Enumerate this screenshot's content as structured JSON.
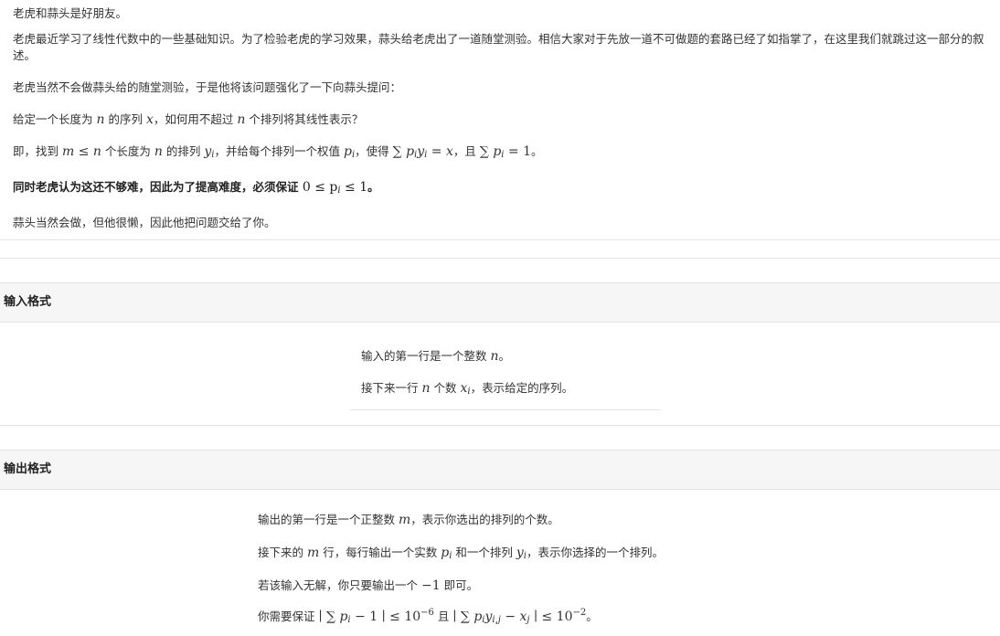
{
  "intro": {
    "p1": "老虎和蒜头是好朋友。",
    "p2": "老虎最近学习了线性代数中的一些基础知识。为了检验老虎的学习效果，蒜头给老虎出了一道随堂测验。相信大家对于先放一道不可做题的套路已经了如指掌了，在这里我们就跳过这一部分的叙述。",
    "p3": "老虎当然不会做蒜头给的随堂测验，于是他将该问题强化了一下向蒜头提问：",
    "p4a": "给定一个长度为 ",
    "p4b": " 的序列 ",
    "p4c": "，如何用不超过 ",
    "p4d": " 个排列将其线性表示？",
    "p5a": "即，找到 ",
    "p5b": " 个长度为 ",
    "p5c": " 的排列 ",
    "p5d": "，并给每个排列一个权值 ",
    "p5e": "，使得 ",
    "p5f": "，且 ",
    "p5g": "。",
    "p6a": "同时老虎认为这还不够难，因此为了提高难度，必须保证 ",
    "p6b": "。",
    "p7": "蒜头当然会做，但他很懒，因此他把问题交给了你。"
  },
  "math": {
    "n": "n",
    "x": "x",
    "m_le_n": "m ≤ n",
    "y_i": "y",
    "p_i": "p",
    "i": "i",
    "sum_py": "∑ p",
    "eq_x": " = x",
    "sum_p": "∑ p",
    "eq_1": " = 1",
    "range": "0 ≤ p",
    "le1": " ≤ 1",
    "m": "m",
    "x_i": "x",
    "minus1": "−1",
    "cond1a": "∣ ∑ p",
    "cond1b": " − 1 ∣ ≤ 10",
    "exp6": "−6",
    "cond2a": "∣ ∑ p",
    "cond2b": "y",
    "cond2c": " − x",
    "cond2d": " ∣ ≤ 10",
    "exp2": "−2",
    "ij": "i,j",
    "j": "j"
  },
  "input_section": {
    "title": "输入格式",
    "l1a": "输入的第一行是一个整数 ",
    "l1b": "。",
    "l2a": "接下来一行 ",
    "l2b": " 个数 ",
    "l2c": "，表示给定的序列。"
  },
  "output_section": {
    "title": "输出格式",
    "l1a": "输出的第一行是一个正整数 ",
    "l1b": "，表示你选出的排列的个数。",
    "l2a": "接下来的 ",
    "l2b": " 行，每行输出一个实数 ",
    "l2c": " 和一个排列 ",
    "l2d": "，表示你选择的一个排列。",
    "l3a": "若该输入无解，你只要输出一个 ",
    "l3b": " 即可。",
    "l4a": "你需要保证 ",
    "l4b": " 且 ",
    "l4c": "。"
  }
}
